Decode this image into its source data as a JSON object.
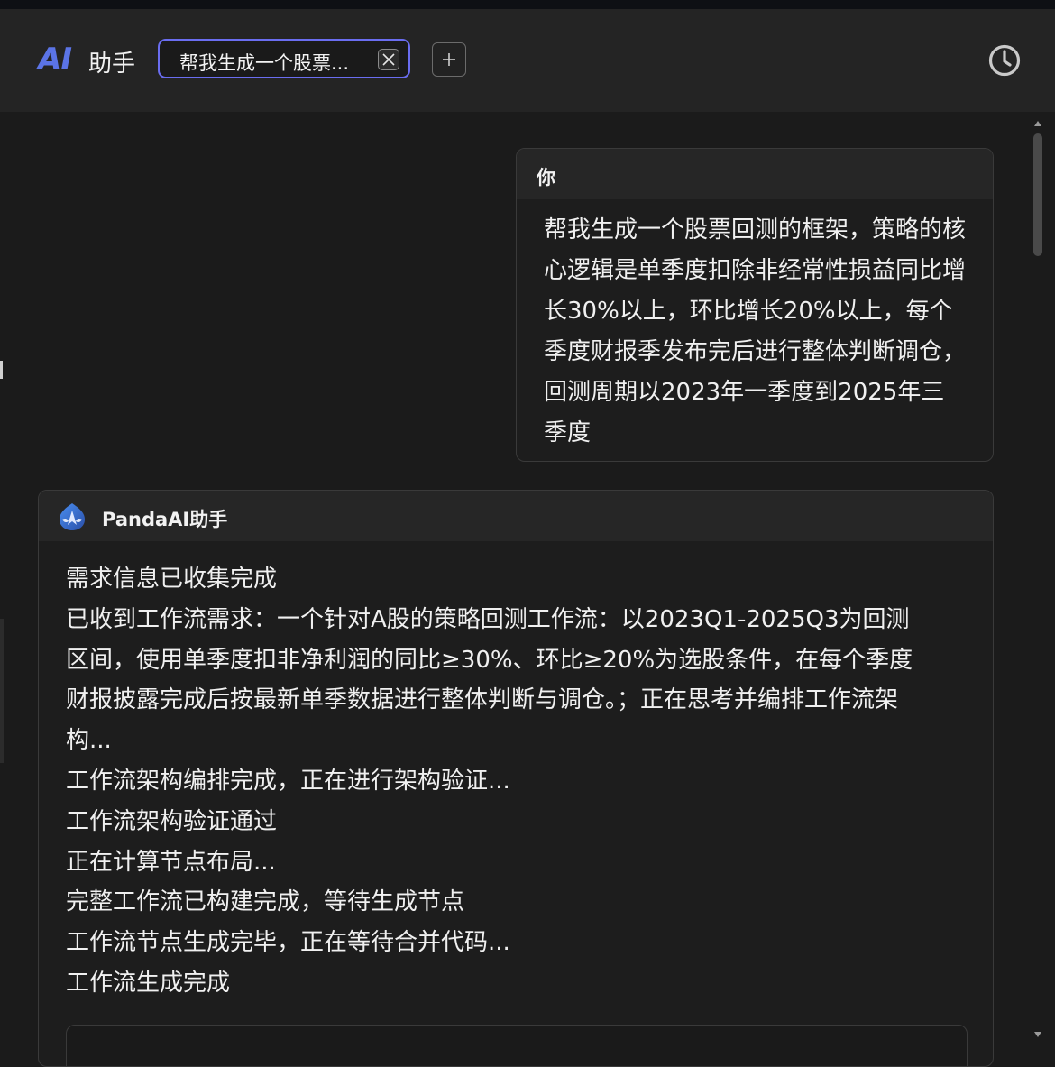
{
  "header": {
    "logo_mark": "AI",
    "logo_text": "助手",
    "tab_label": "帮我生成一个股票...",
    "icons": {
      "close": "close-icon",
      "add": "plus-icon",
      "history": "clock-icon"
    }
  },
  "conversation": {
    "user": {
      "name": "你",
      "message": "帮我生成一个股票回测的框架，策略的核心逻辑是单季度扣除非经常性损益同比增长30%以上，环比增长20%以上，每个季度财报季发布完后进行整体判断调仓，回测周期以2023年一季度到2025年三季度"
    },
    "assistant": {
      "name": "PandaAI助手",
      "lines": [
        "需求信息已收集完成",
        "已收到工作流需求：一个针对A股的策略回测工作流：以2023Q1-2025Q3为回测",
        "区间，使用单季度扣非净利润的同比≥30%、环比≥20%为选股条件，在每个季度",
        "财报披露完成后按最新单季数据进行整体判断与调仓。；正在思考并编排工作流架",
        "构...",
        "工作流架构编排完成，正在进行架构验证...",
        "工作流架构验证通过",
        "正在计算节点布局...",
        "完整工作流已构建完成，等待生成节点",
        "工作流节点生成完毕，正在等待合并代码...",
        "工作流生成完成"
      ]
    }
  },
  "colors": {
    "accent": "#5b74e6",
    "tab_border": "#6a6df0",
    "background": "#1b1b1b",
    "card_header": "#262626"
  }
}
